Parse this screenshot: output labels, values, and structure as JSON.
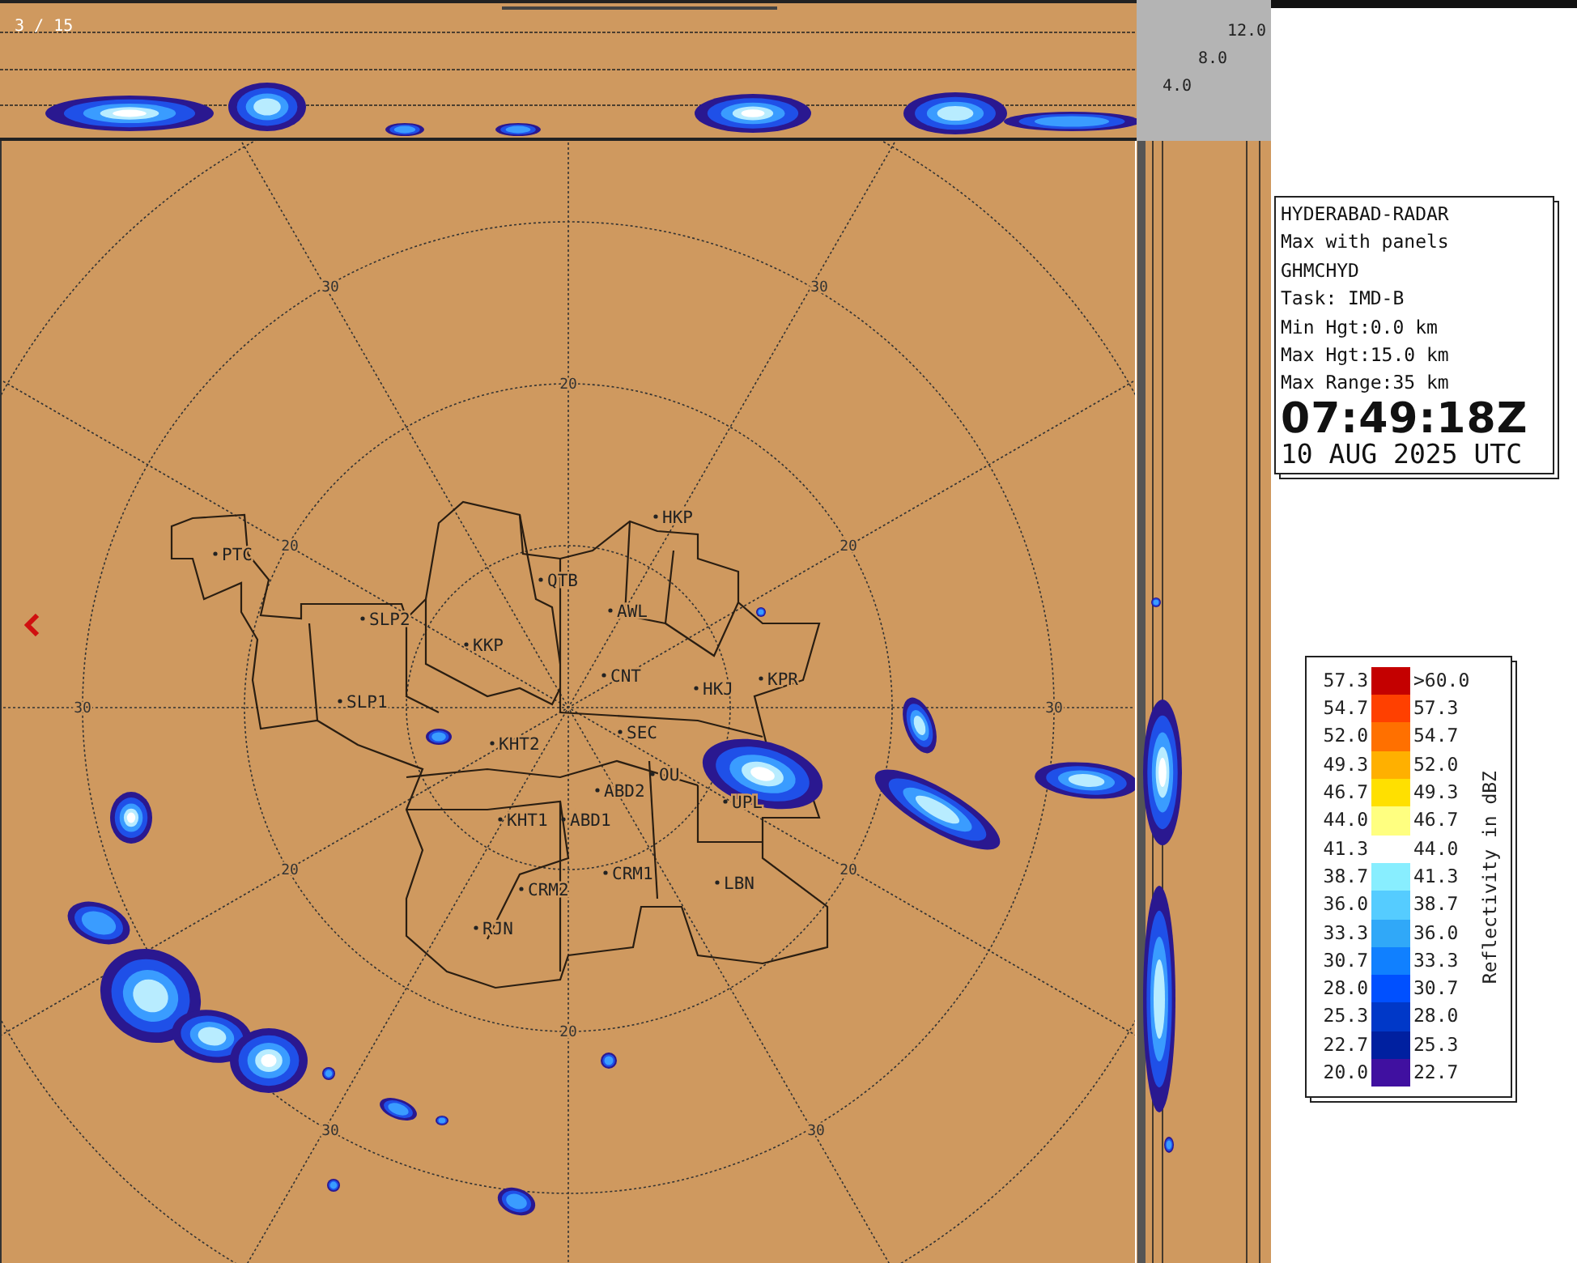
{
  "frame_counter": "3 / 15",
  "height_scale": [
    "12.0",
    "8.0",
    "4.0"
  ],
  "range_labels": [
    "30",
    "30",
    "20",
    "20",
    "20",
    "30",
    "30",
    "20",
    "20",
    "20",
    "30",
    "30"
  ],
  "stations": [
    "HKP",
    "PTC",
    "QTB",
    "AWL",
    "SLP2",
    "KKP",
    "CNT",
    "KPR",
    "HKJ",
    "SLP1",
    "SEC",
    "KHT2",
    "OU",
    "ABD2",
    "UPL",
    "KHT1",
    "ABD1",
    "CRM1",
    "LBN",
    "CRM2",
    "RJN"
  ],
  "info_panel": {
    "lines": [
      "HYDERABAD-RADAR",
      "Max with panels",
      "GHMCHYD",
      "Task: IMD-B",
      "Min Hgt:0.0 km",
      "Max Hgt:15.0 km",
      "Max Range:35 km"
    ],
    "time": "07:49:18Z",
    "date": "10 AUG 2025 UTC"
  },
  "legend": {
    "title": "Reflectivity in dBZ",
    "rows": [
      {
        "low": "57.3",
        "high": ">60.0",
        "color": "#c40000"
      },
      {
        "low": "54.7",
        "high": "57.3",
        "color": "#ff4000"
      },
      {
        "low": "52.0",
        "high": "54.7",
        "color": "#ff7000"
      },
      {
        "low": "49.3",
        "high": "52.0",
        "color": "#ffb000"
      },
      {
        "low": "46.7",
        "high": "49.3",
        "color": "#ffe000"
      },
      {
        "low": "44.0",
        "high": "46.7",
        "color": "#ffff80"
      },
      {
        "low": "41.3",
        "high": "44.0",
        "color": "#ffffff"
      },
      {
        "low": "38.7",
        "high": "41.3",
        "color": "#88eeff"
      },
      {
        "low": "36.0",
        "high": "38.7",
        "color": "#55ccff"
      },
      {
        "low": "33.3",
        "high": "36.0",
        "color": "#30a8f8"
      },
      {
        "low": "30.7",
        "high": "33.3",
        "color": "#1080ff"
      },
      {
        "low": "28.0",
        "high": "30.7",
        "color": "#0050ff"
      },
      {
        "low": "25.3",
        "high": "28.0",
        "color": "#0038c8"
      },
      {
        "low": "22.7",
        "high": "25.3",
        "color": "#0020a0"
      },
      {
        "low": "20.0",
        "high": "22.7",
        "color": "#4010a0"
      }
    ]
  }
}
